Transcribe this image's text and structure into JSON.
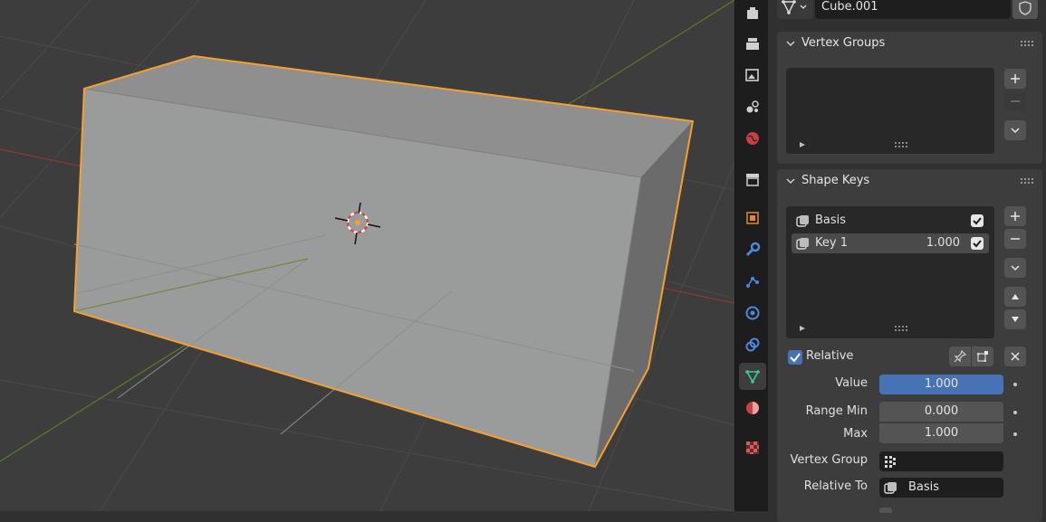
{
  "properties": {
    "object_name": "Cube.001",
    "vertex_groups": {
      "title": "Vertex Groups"
    },
    "shape_keys": {
      "title": "Shape Keys",
      "keys": [
        {
          "name": "Basis",
          "value": "",
          "enabled": true
        },
        {
          "name": "Key 1",
          "value": "1.000",
          "enabled": true
        }
      ],
      "relative_label": "Relative",
      "relative_checked": true,
      "value_label": "Value",
      "value": "1.000",
      "value_fraction": 1.0,
      "range_min_label": "Range Min",
      "range_min": "0.000",
      "max_label": "Max",
      "max": "1.000",
      "vertex_group_label": "Vertex Group",
      "vertex_group": "",
      "relative_to_label": "Relative To",
      "relative_to": "Basis"
    }
  },
  "colors": {
    "accent_blue": "#4772b3",
    "selection_orange": "#f5a030",
    "viewport_bg": "#3d3d3d",
    "panel_bg": "#3d3d3d"
  },
  "icons": [
    "tool-icon",
    "render-icon",
    "output-icon",
    "view-layer-icon",
    "scene-icon",
    "world-icon",
    "collection-icon",
    "object-icon",
    "modifier-icon",
    "particles-icon",
    "physics-icon",
    "constraints-icon",
    "data-icon",
    "material-icon",
    "texture-icon",
    "mesh-data-icon",
    "shield-icon"
  ]
}
